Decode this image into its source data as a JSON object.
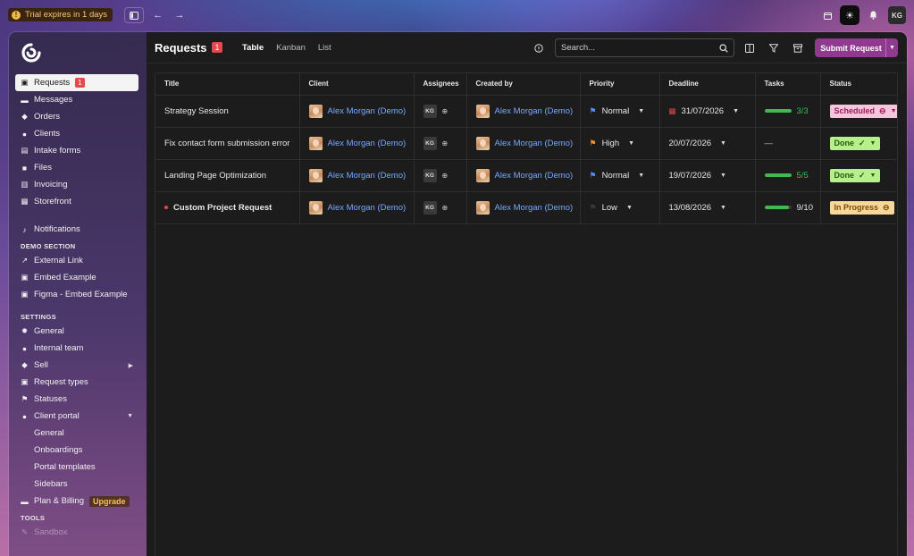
{
  "topbar": {
    "trial_text": "Trial expires in 1 days",
    "avatar_initials": "KG"
  },
  "sidebar": {
    "items": [
      {
        "label": "Requests",
        "icon": "inbox-icon",
        "badge": "1",
        "active": true
      },
      {
        "label": "Messages",
        "icon": "chat-icon"
      },
      {
        "label": "Orders",
        "icon": "box-icon"
      },
      {
        "label": "Clients",
        "icon": "person-icon"
      },
      {
        "label": "Intake forms",
        "icon": "form-icon"
      },
      {
        "label": "Files",
        "icon": "folder-icon"
      },
      {
        "label": "Invoicing",
        "icon": "invoice-icon"
      },
      {
        "label": "Storefront",
        "icon": "store-icon"
      }
    ],
    "notifications_label": "Notifications",
    "demo_section_title": "DEMO SECTION",
    "demo_items": [
      {
        "label": "External Link",
        "icon": "external-link-icon"
      },
      {
        "label": "Embed Example",
        "icon": "embed-icon"
      },
      {
        "label": "Figma - Embed Example",
        "icon": "embed-icon"
      }
    ],
    "settings_title": "SETTINGS",
    "settings_items": [
      {
        "label": "General",
        "icon": "gear-icon"
      },
      {
        "label": "Internal team",
        "icon": "team-icon"
      },
      {
        "label": "Sell",
        "icon": "tag-icon"
      },
      {
        "label": "Request types",
        "icon": "request-types-icon"
      },
      {
        "label": "Statuses",
        "icon": "flag-icon"
      },
      {
        "label": "Client portal",
        "icon": "portal-icon"
      }
    ],
    "client_portal_sub": [
      "General",
      "Onboardings",
      "Portal templates",
      "Sidebars"
    ],
    "plan_label": "Plan & Billing",
    "upgrade_label": "Upgrade",
    "tools_title": "TOOLS",
    "sandbox_label": "Sandbox"
  },
  "main": {
    "title": "Requests",
    "title_badge": "1",
    "tabs": [
      "Table",
      "Kanban",
      "List"
    ],
    "active_tab": "Table",
    "search_placeholder": "Search...",
    "submit_label": "Submit Request"
  },
  "table": {
    "columns": [
      "Title",
      "Client",
      "Assignees",
      "Created by",
      "Priority",
      "Deadline",
      "Tasks",
      "Status"
    ],
    "rows": [
      {
        "title": "Strategy Session",
        "client": "Alex Morgan (Demo)",
        "assignee": "KG",
        "created_by": "Alex Morgan (Demo)",
        "priority": "Normal",
        "priority_color": "#5b8def",
        "deadline": "31/07/2026",
        "deadline_overdue": true,
        "tasks": "3/3",
        "tasks_progress": 1.0,
        "status": "Scheduled",
        "status_kind": "scheduled"
      },
      {
        "title": "Fix contact form submission error",
        "client": "Alex Morgan (Demo)",
        "assignee": "KG",
        "created_by": "Alex Morgan (Demo)",
        "priority": "High",
        "priority_color": "#e8962e",
        "deadline": "20/07/2026",
        "deadline_overdue": false,
        "tasks": "—",
        "tasks_progress": null,
        "status": "Done",
        "status_kind": "done"
      },
      {
        "title": "Landing Page Optimization",
        "client": "Alex Morgan (Demo)",
        "assignee": "KG",
        "created_by": "Alex Morgan (Demo)",
        "priority": "Normal",
        "priority_color": "#5b8def",
        "deadline": "19/07/2026",
        "deadline_overdue": false,
        "tasks": "5/5",
        "tasks_progress": 1.0,
        "status": "Done",
        "status_kind": "done"
      },
      {
        "title": "Custom Project Request",
        "client": "Alex Morgan (Demo)",
        "assignee": "KG",
        "created_by": "Alex Morgan (Demo)",
        "priority": "Low",
        "priority_color": "#3a3a3a",
        "deadline": "13/08/2026",
        "deadline_overdue": false,
        "tasks": "9/10",
        "tasks_progress": 0.9,
        "status": "In Progress",
        "status_kind": "progress",
        "unread": true
      }
    ]
  }
}
